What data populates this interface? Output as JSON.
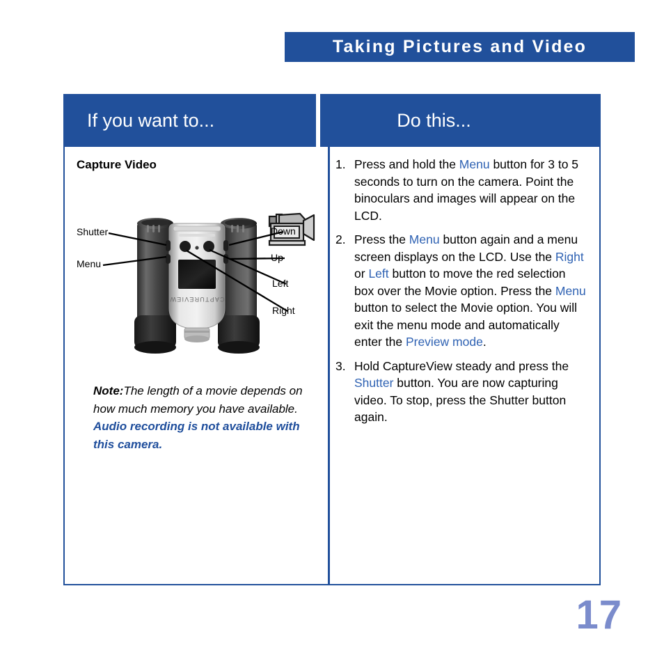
{
  "header": {
    "banner_title": "Taking Pictures and Video",
    "banner_color": "#21509b"
  },
  "table": {
    "columns": [
      {
        "header": "If you want to...",
        "align": "left"
      },
      {
        "header": "Do this...",
        "align": "center"
      }
    ],
    "border_color": "#21509b"
  },
  "left_column": {
    "task_title": "Capture Video",
    "task_icon": "camcorder-icon",
    "figure": {
      "device_name": "CAPTUREVIEW",
      "alt": "binoculars-with-digital-camera",
      "labels": [
        {
          "text": "Shutter",
          "side": "left"
        },
        {
          "text": "Menu",
          "side": "left"
        },
        {
          "text": "Down",
          "side": "right"
        },
        {
          "text": "Up",
          "side": "right"
        },
        {
          "text": "Left",
          "side": "right"
        },
        {
          "text": "Right",
          "side": "right"
        }
      ]
    },
    "note": {
      "keyword": "Note:",
      "body": "The length of a movie depends on how much memory you have available. ",
      "highlight": "Audio recording is not available with this camera.",
      "highlight_color": "#1f4e9c"
    }
  },
  "right_column": {
    "steps": [
      {
        "number": "1.",
        "parts": [
          {
            "t": "Press and hold the ",
            "k": false
          },
          {
            "t": "Menu",
            "k": true
          },
          {
            "t": " button for 3 to 5 seconds to turn on the camera. Point the binoculars and images will appear on the LCD.",
            "k": false
          }
        ]
      },
      {
        "number": "2.",
        "parts": [
          {
            "t": "Press the ",
            "k": false
          },
          {
            "t": "Menu",
            "k": true
          },
          {
            "t": " button again and a menu screen displays on the LCD. Use the ",
            "k": false
          },
          {
            "t": "Right",
            "k": true
          },
          {
            "t": " or ",
            "k": false
          },
          {
            "t": "Left",
            "k": true
          },
          {
            "t": " button to move the red selection box over the Movie option. Press the ",
            "k": false
          },
          {
            "t": "Menu",
            "k": true
          },
          {
            "t": " button to select the Movie option. You will exit the menu mode and automatically enter the ",
            "k": false
          },
          {
            "t": "Preview mode",
            "k": true
          },
          {
            "t": ".",
            "k": false
          }
        ]
      },
      {
        "number": "3.",
        "parts": [
          {
            "t": "Hold CaptureView steady and press the ",
            "k": false
          },
          {
            "t": "Shutter",
            "k": true
          },
          {
            "t": " button. You are now capturing video. To stop, press the Shutter button again.",
            "k": false
          }
        ]
      }
    ],
    "keyword_color": "#2f62b3"
  },
  "footer": {
    "page_number": "17",
    "page_number_color": "#7b8ccc"
  }
}
